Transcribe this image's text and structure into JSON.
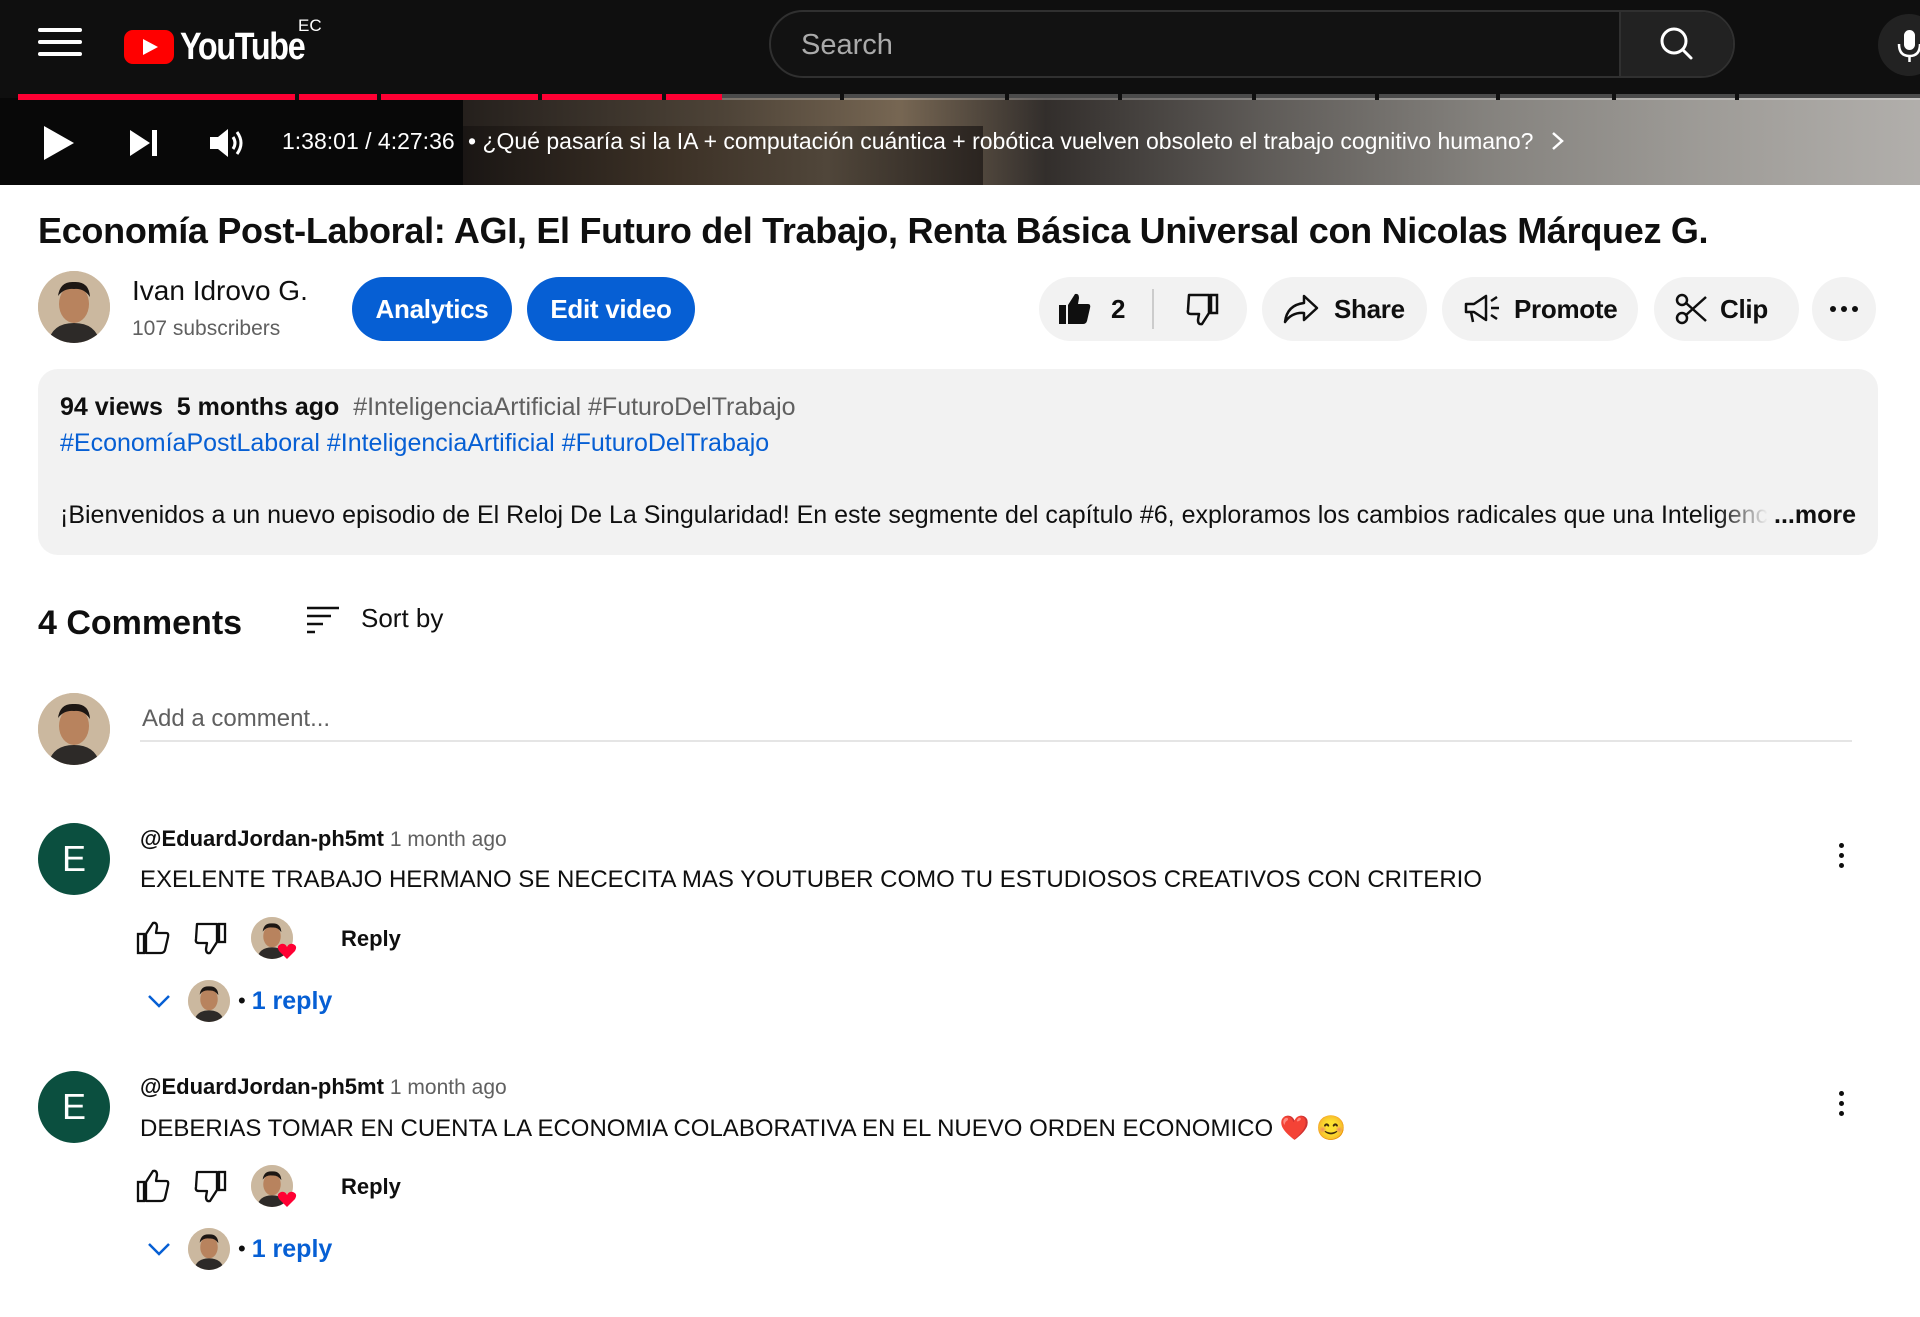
{
  "header": {
    "logo_text": "YouTube",
    "country_code": "EC",
    "search_placeholder": "Search"
  },
  "player": {
    "time": "1:38:01 / 4:27:36",
    "chapter": "• ¿Qué pasaría si la IA + computación cuántica + robótica vuelven obsoleto el trabajo cognitivo humano?",
    "progress_fraction": 0.37
  },
  "video": {
    "title": "Economía Post-Laboral: AGI, El Futuro del Trabajo, Renta Básica Universal con Nicolas Márquez G."
  },
  "channel": {
    "name": "Ivan Idrovo G.",
    "subscribers": "107 subscribers",
    "analytics_label": "Analytics",
    "edit_label": "Edit video"
  },
  "actions": {
    "likes": "2",
    "share_label": "Share",
    "promote_label": "Promote",
    "clip_label": "Clip"
  },
  "description": {
    "views": "94 views",
    "age": "5 months ago",
    "meta_tags": "#InteligenciaArtificial #FuturoDelTrabajo",
    "tags": [
      "#EconomíaPostLaboral",
      "#InteligenciaArtificial",
      "#FuturoDelTrabajo"
    ],
    "text": "¡Bienvenidos a un nuevo episodio de El Reloj De La Singularidad! En este segmente del capítulo #6, exploramos los cambios radicales que una Inteligencia Artificial General",
    "more_label": "...more"
  },
  "comments": {
    "count_label": "4 Comments",
    "sort_label": "Sort by",
    "add_placeholder": "Add a comment...",
    "items": [
      {
        "initial": "E",
        "author": "@EduardJordan-ph5mt",
        "time": "1 month ago",
        "text": "EXELENTE TRABAJO HERMANO SE NECECITA MAS YOUTUBER COMO TU ESTUDIOSOS CREATIVOS CON CRITERIO",
        "reply_label": "Reply",
        "replies_label": "1 reply"
      },
      {
        "initial": "E",
        "author": "@EduardJordan-ph5mt",
        "time": "1 month ago",
        "text": "DEBERIAS TOMAR EN CUENTA LA ECONOMIA COLABORATIVA EN EL NUEVO ORDEN ECONOMICO ❤️ 😊",
        "reply_label": "Reply",
        "replies_label": "1 reply"
      }
    ]
  },
  "colors": {
    "brand_red": "#ff0000",
    "progress_red": "#ff0033",
    "link_blue": "#065fd4",
    "comment_avatar": "#0b4f3f"
  }
}
